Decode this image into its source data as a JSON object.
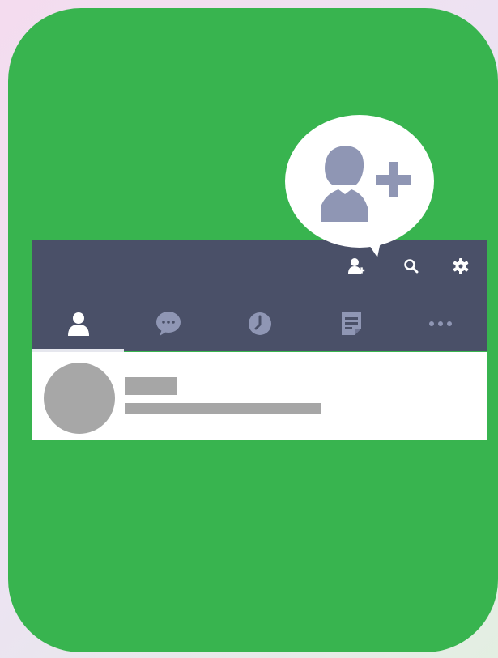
{
  "icons": {
    "callout": "add-friend-icon",
    "toolbar": [
      "add-friend-icon",
      "search-icon",
      "settings-gear-icon"
    ],
    "tabs": [
      "friends-icon",
      "chats-icon",
      "timeline-icon",
      "notes-icon",
      "more-icon"
    ]
  },
  "colors": {
    "card": "#38b44f",
    "header": "#4a5068",
    "icon_muted": "#8f96b4",
    "placeholder": "#a6a6a6"
  }
}
